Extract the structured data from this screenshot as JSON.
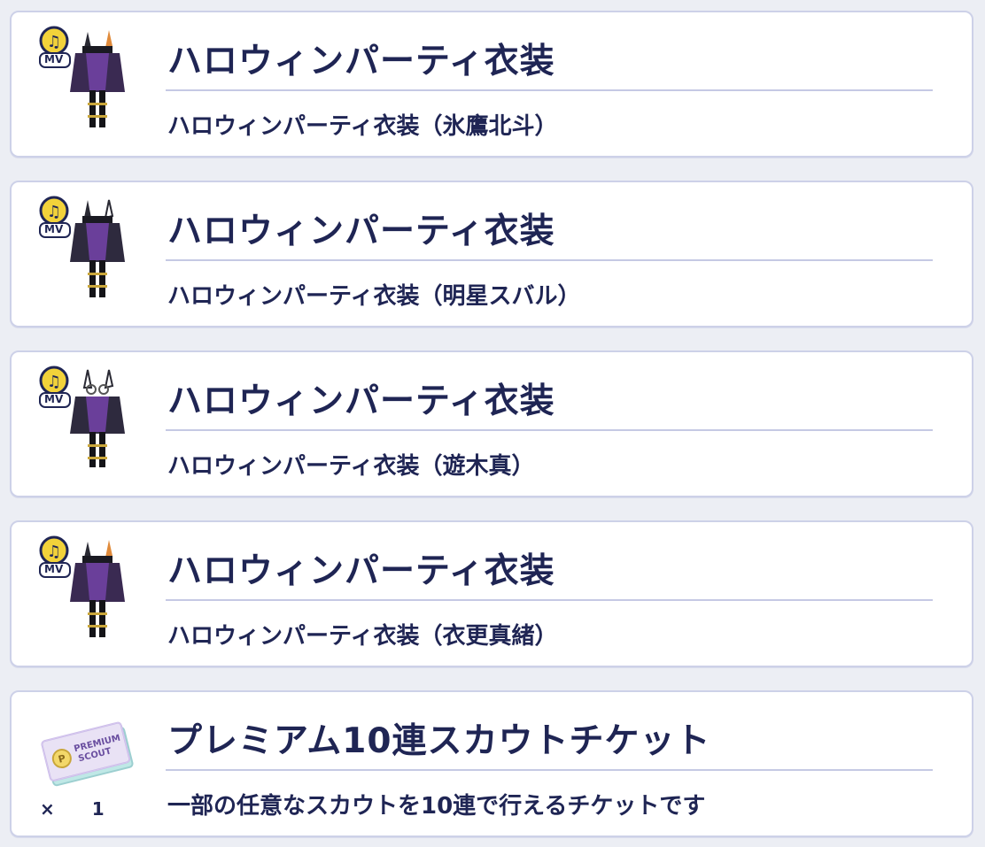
{
  "rewards": [
    {
      "title": "ハロウィンパーティ衣装",
      "subtitle": "ハロウィンパーティ衣装（氷鷹北斗）",
      "icon": "costume-mv-icon",
      "badge": "MV"
    },
    {
      "title": "ハロウィンパーティ衣装",
      "subtitle": "ハロウィンパーティ衣装（明星スバル）",
      "icon": "costume-mv-icon",
      "badge": "MV"
    },
    {
      "title": "ハロウィンパーティ衣装",
      "subtitle": "ハロウィンパーティ衣装（遊木真）",
      "icon": "costume-mv-icon",
      "badge": "MV"
    },
    {
      "title": "ハロウィンパーティ衣装",
      "subtitle": "ハロウィンパーティ衣装（衣更真緒）",
      "icon": "costume-mv-icon",
      "badge": "MV"
    },
    {
      "title": "プレミアム10連スカウトチケット",
      "subtitle": "一部の任意なスカウトを10連で行えるチケットです",
      "icon": "scout-ticket-icon",
      "ticket_text": [
        "PREMIUM",
        "SCOUT"
      ],
      "qty_symbol": "×",
      "quantity": "1"
    }
  ],
  "colors": {
    "text": "#1f2554",
    "card_border": "#cdd1e8",
    "background": "#eceef4",
    "mv_badge": "#f2d23a",
    "costume_purple": "#6a3f9a"
  }
}
